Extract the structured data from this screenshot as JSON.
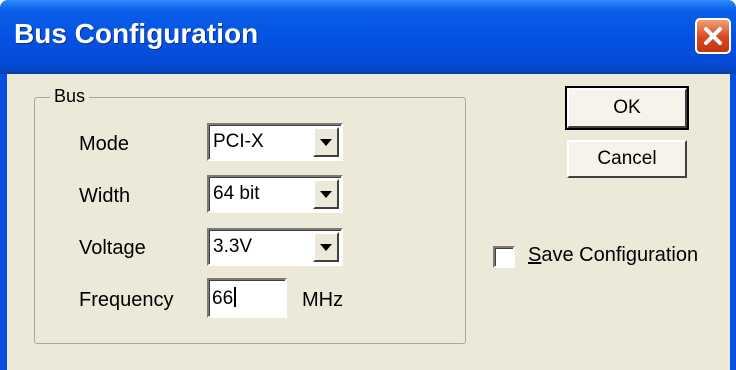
{
  "window": {
    "title": "Bus Configuration"
  },
  "bus_group": {
    "legend": "Bus"
  },
  "mode": {
    "label": "Mode",
    "value": "PCI-X"
  },
  "width": {
    "label": "Width",
    "value": "64 bit"
  },
  "voltage": {
    "label": "Voltage",
    "value": "3.3V"
  },
  "frequency": {
    "label": "Frequency",
    "value": "66",
    "unit": "MHz"
  },
  "buttons": {
    "ok": "OK",
    "cancel": "Cancel"
  },
  "save_config": {
    "mnemonic": "S",
    "rest": "ave Configuration",
    "checked": false
  },
  "colors": {
    "titlebar": "#0553e3",
    "dialog_bg": "#ece9d8",
    "close_button": "#d6481f"
  },
  "icons": {
    "close": "close-x-icon",
    "dropdown": "chevron-down-icon"
  }
}
